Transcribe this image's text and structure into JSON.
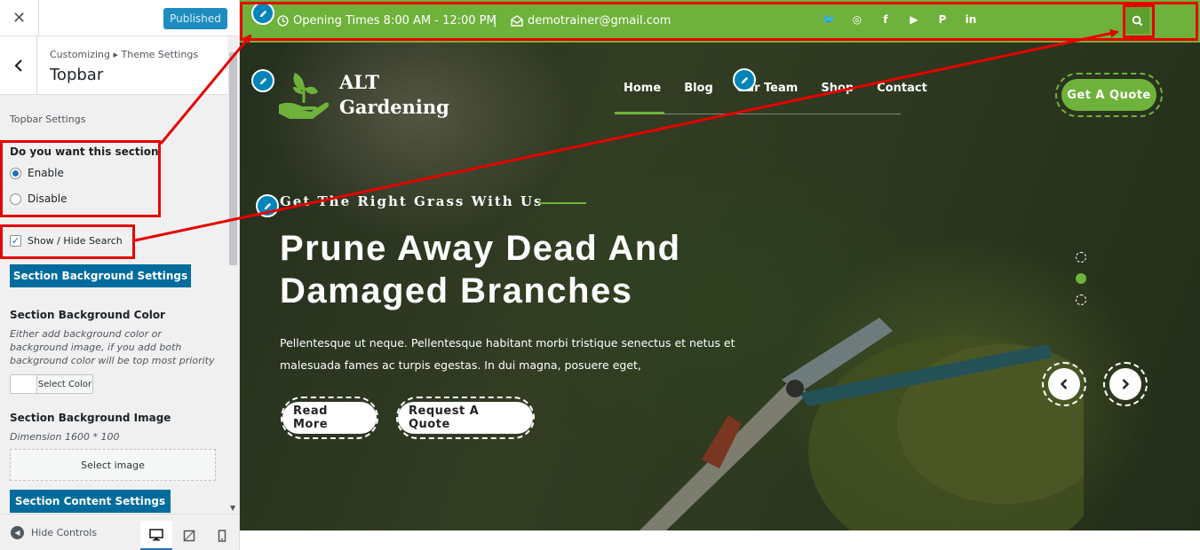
{
  "customizer": {
    "close_label": "✕",
    "publish_label": "Published",
    "breadcrumb": "Customizing ▸ Theme Settings",
    "section_title": "Topbar",
    "group_label": "Topbar Settings",
    "question": "Do you want this section",
    "options": [
      {
        "label": "Enable",
        "checked": true
      },
      {
        "label": "Disable",
        "checked": false
      }
    ],
    "search_toggle_label": "Show / Hide Search",
    "search_toggle_checked": true,
    "bg_settings_button": "Section Background Settings",
    "bg_color_heading": "Section Background Color",
    "bg_color_desc": "Either add background color or background image, if you add both background color will be top most priority",
    "select_color_label": "Select Color",
    "bg_image_heading": "Section Background Image",
    "bg_image_dimension": "Dimension 1600 * 100",
    "select_image_label": "Select image",
    "content_settings_button": "Section Content Settings",
    "hide_controls_label": "Hide Controls"
  },
  "topbar": {
    "opening_times": "Opening Times 8:00 AM - 12:00 PM",
    "separator": "|",
    "email": "demotrainer@gmail.com",
    "socials": [
      "twitter-icon",
      "instagram-icon",
      "facebook-icon",
      "youtube-icon",
      "pinterest-icon",
      "linkedin-icon"
    ],
    "social_glyphs": [
      "🐦",
      "◎",
      "f",
      "▶",
      "P",
      "in"
    ],
    "bg_color": "#6fb23b"
  },
  "header": {
    "logo_line1": "ALT",
    "logo_line2": "Gardening",
    "nav": [
      "Home",
      "Blog",
      "Our Team",
      "Shop",
      "Contact"
    ],
    "active_nav": "Home",
    "quote_button": "Get A Quote"
  },
  "hero": {
    "tagline": "Get The Right Grass With Us",
    "headline_line1": "Prune Away Dead And",
    "headline_line2": "Damaged Branches",
    "paragraph": "Pellentesque ut neque. Pellentesque habitant morbi tristique senectus et netus et malesuada fames ac turpis egestas. In dui magna, posuere eget,",
    "read_more": "Read More",
    "request_quote": "Request A Quote",
    "slide_count": 3,
    "active_slide": 2
  },
  "colors": {
    "accent_green": "#6fb23b",
    "wp_blue": "#006c9e",
    "annotation_red": "#e60000"
  }
}
